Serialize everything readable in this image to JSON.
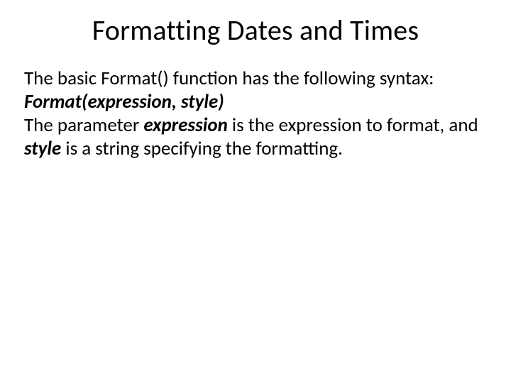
{
  "title": "Formatting Dates and Times",
  "body": {
    "p1a": "The basic Format() function has the following syntax:",
    "p2_sig": "Format(expression, style)",
    "p3a": "The parameter ",
    "p3b": "expression",
    "p3c": " is the expression to format, and ",
    "p3d": "style",
    "p3e": " is a string specifying the formatting."
  }
}
